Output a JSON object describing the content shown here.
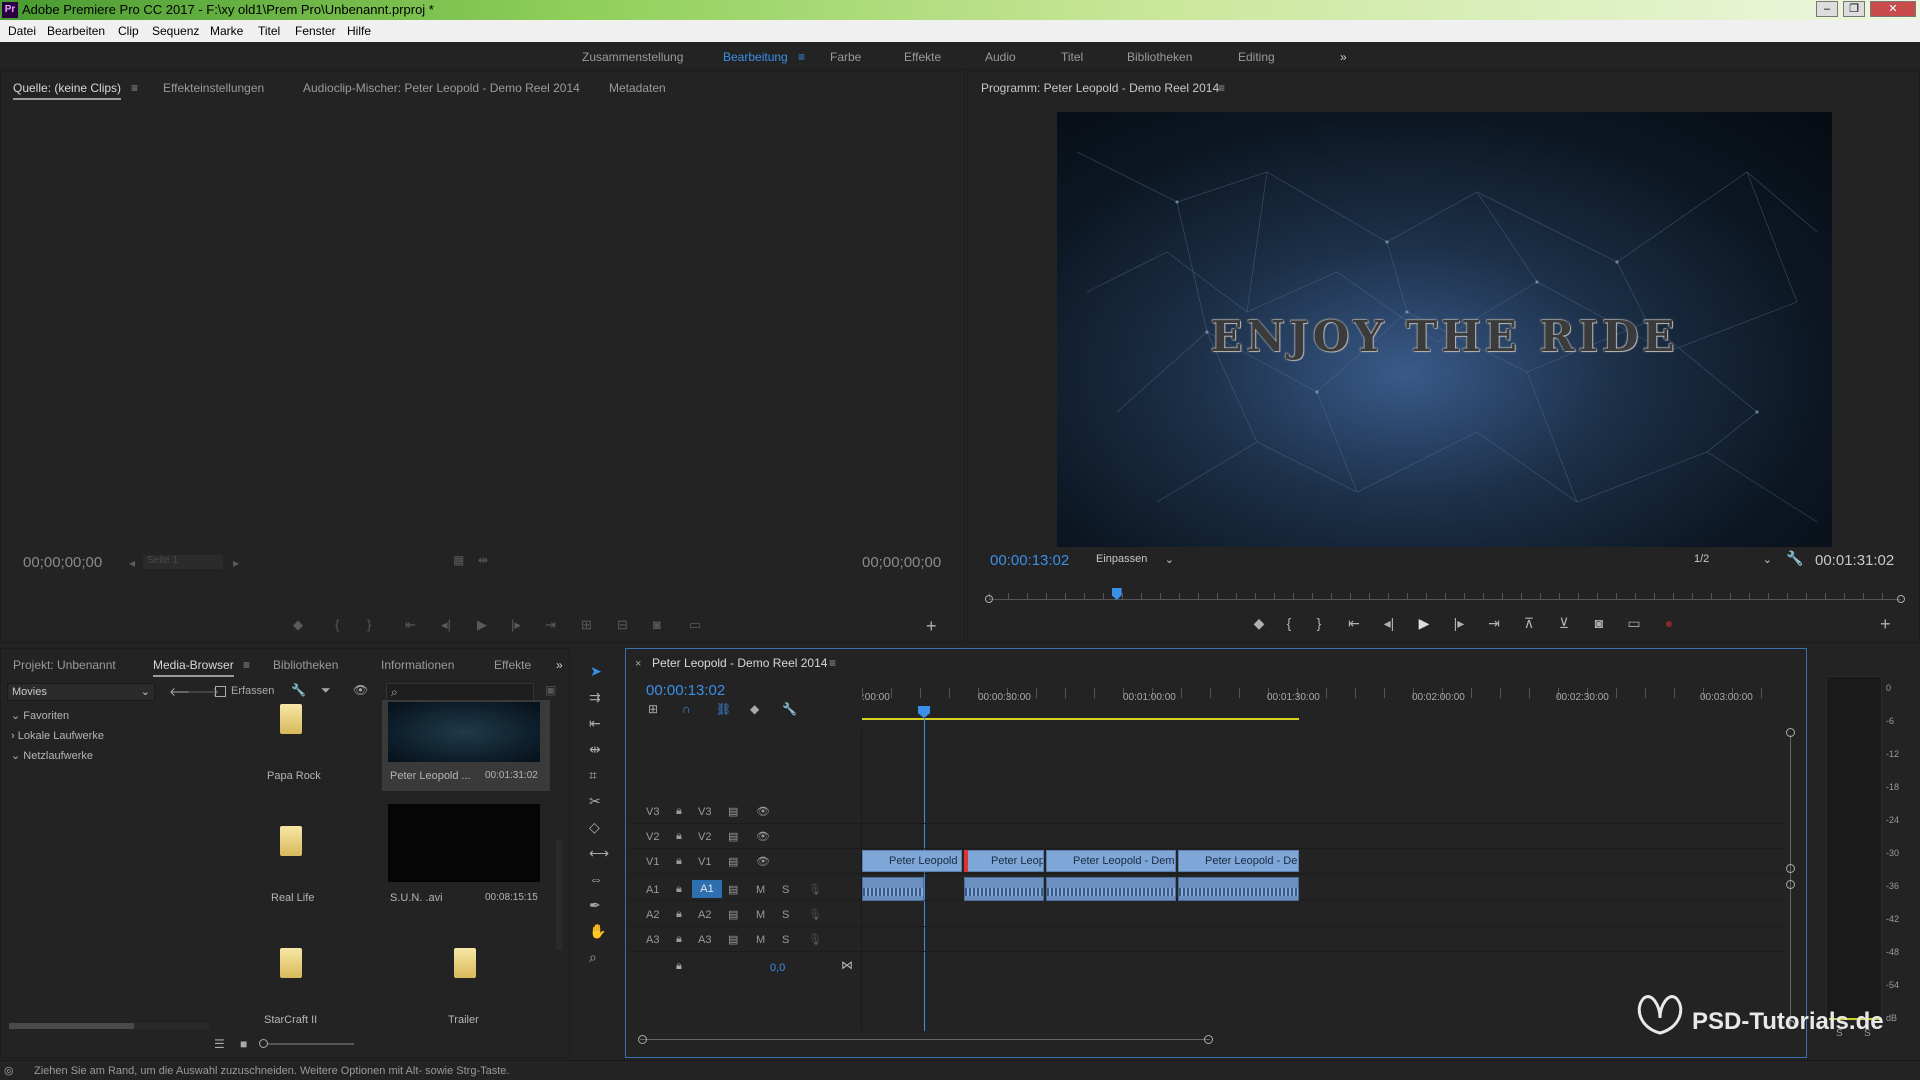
{
  "app": {
    "window_title": "Adobe Premiere Pro CC 2017 - F:\\xy old1\\Prem Pro\\Unbenannt.prproj *",
    "icon_text": "Pr"
  },
  "menu": [
    "Datei",
    "Bearbeiten",
    "Clip",
    "Sequenz",
    "Marke",
    "Titel",
    "Fenster",
    "Hilfe"
  ],
  "workspaces": {
    "items": [
      "Zusammenstellung",
      "Bearbeitung",
      "Farbe",
      "Effekte",
      "Audio",
      "Titel",
      "Bibliotheken",
      "Editing"
    ],
    "active": "Bearbeitung",
    "overflow": "»"
  },
  "source_panel": {
    "tabs": [
      "Quelle: (keine Clips)",
      "Effekteinstellungen",
      "Audioclip-Mischer: Peter Leopold - Demo Reel 2014",
      "Metadaten"
    ],
    "timecode_left": "00;00;00;00",
    "page_label": "Seite 1",
    "timecode_right": "00;00;00;00"
  },
  "program_panel": {
    "title": "Programm: Peter Leopold - Demo Reel 2014",
    "overlay_text": "ENJOY THE RIDE",
    "timecode": "00:00:13:02",
    "fit": "Einpassen",
    "resolution": "1/2",
    "duration": "00:01:31:02",
    "playhead_fraction": 0.14
  },
  "project_panel": {
    "tabs": [
      "Projekt: Unbenannt",
      "Media-Browser",
      "Bibliotheken",
      "Informationen",
      "Effekte"
    ],
    "active_tab": "Media-Browser",
    "location": "Movies",
    "ingest_label": "Erfassen",
    "tree": [
      "Favoriten",
      "Lokale Laufwerke",
      "Netzlaufwerke"
    ],
    "items": [
      {
        "name": "Papa Rock",
        "type": "folder",
        "duration": ""
      },
      {
        "name": "Peter Leopold ...",
        "type": "video",
        "duration": "00:01:31:02"
      },
      {
        "name": "Real Life",
        "type": "folder",
        "duration": ""
      },
      {
        "name": "S.U.N. .avi",
        "type": "video",
        "duration": "00:08:15:15"
      },
      {
        "name": "StarCraft II",
        "type": "folder",
        "duration": ""
      },
      {
        "name": "Trailer",
        "type": "folder",
        "duration": ""
      }
    ]
  },
  "timeline": {
    "title": "Peter Leopold - Demo Reel 2014",
    "timecode": "00:00:13:02",
    "ruler": [
      ":00:00",
      "00:00:30:00",
      "00:01:00:00",
      "00:01:30:00",
      "00:02:00:00",
      "00:02:30:00",
      "00:03:00:00"
    ],
    "video_tracks": [
      "V3",
      "V2",
      "V1"
    ],
    "audio_tracks": [
      "A3",
      "A2",
      "A1"
    ],
    "mute": "M",
    "solo": "S",
    "master_value": "0,0",
    "clips": [
      "Peter Leopold",
      "Peter Leop",
      "Peter Leopold - Dem",
      "Peter Leopold - De"
    ]
  },
  "meter": {
    "scale": [
      "0",
      "-6",
      "-12",
      "-18",
      "-24",
      "-30",
      "-36",
      "-42",
      "-48",
      "-54",
      "dB"
    ],
    "labels": [
      "S",
      "S"
    ]
  },
  "watermark": "PSD-Tutorials.de",
  "status": "Ziehen Sie am Rand, um die Auswahl zuzuschneiden. Weitere Optionen mit Alt- sowie Strg-Taste."
}
